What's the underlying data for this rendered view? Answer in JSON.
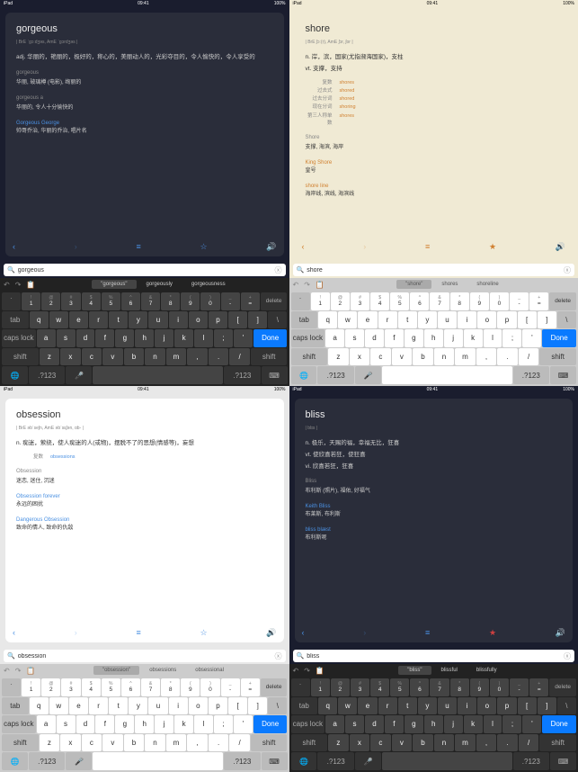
{
  "status_time": "09:41",
  "status_left": "iPad",
  "panels": [
    {
      "word": "gorgeous",
      "pron": "| BrE ˈɡɔːdʒəs, AmE ˈɡɔrdʒəs |",
      "defs": [
        "adj. 华丽的，艳丽的，极好的，称心的，美丽动人的，光彩夺目的，令人愉快的，令人享受的"
      ],
      "sections": [
        {
          "head": "gorgeous",
          "body": "华丽, 玻璃樽 (电影), 绚丽的"
        },
        {
          "head": "gorgeous a",
          "body": "华丽的, 令人十分愉快的"
        },
        {
          "head_link": "Gorgeous George",
          "body": "帅哥乔治, 华丽的乔治, 唱片名"
        }
      ],
      "search": "gorgeous",
      "suggest": [
        "\"gorgeous\"",
        "gorgeously",
        "gorgeousness"
      ]
    },
    {
      "word": "shore",
      "pron": "| BrE ʃɔː(r), AmE ʃɔr, ʃor |",
      "defs": [
        "n. 岸，滨，国家(尤指濒海国家)，支柱",
        "vt. 支撑，支持"
      ],
      "forms": [
        {
          "label": "复数",
          "value": "shores"
        },
        {
          "label": "过去式",
          "value": "shored"
        },
        {
          "label": "过去分词",
          "value": "shored"
        },
        {
          "label": "现在分词",
          "value": "shoring"
        },
        {
          "label": "第三人称单数",
          "value": "shores"
        }
      ],
      "sections": [
        {
          "head": "Shore",
          "body": "支撑, 海滨, 海岸"
        },
        {
          "head_link": "King Shore",
          "body": "皇号"
        },
        {
          "head_link": "shore line",
          "body": "海岸线, 滨线, 海滨线"
        }
      ],
      "search": "shore",
      "suggest": [
        "\"shore\"",
        "shores",
        "shoreline"
      ]
    },
    {
      "word": "obsession",
      "pron": "| BrE əbˈseʃn, AmE əbˈsɛʃən, ɑb- |",
      "defs": [
        "n. 痴迷，萦绕，使人痴迷的人(或物)，摆脱不了的思想(情感等)，妄想"
      ],
      "forms": [
        {
          "label": "复数",
          "value": "obsessions"
        }
      ],
      "sections": [
        {
          "head": "Obsession",
          "body": "迷恋, 迷住, 沉迷"
        },
        {
          "head_link": "Obsession forever",
          "body": "永远的困扰"
        },
        {
          "head_link": "Dangerous Obsession",
          "body": "致命的情人, 致命的仇敌"
        }
      ],
      "search": "obsession",
      "suggest": [
        "\"obsession\"",
        "obsessions",
        "obsessional"
      ]
    },
    {
      "word": "bliss",
      "pron": "| blɪs |",
      "defs": [
        "n. 极乐，天赐的福，幸福无比，狂喜",
        "vt. 使欣喜若狂，使狂喜",
        "vi. 欣喜若狂，狂喜"
      ],
      "sections": [
        {
          "head": "Bliss",
          "body": "布利斯 (照片), 福佑, 好福气"
        },
        {
          "head_link": "Keith Bliss",
          "body": "布莱斯, 布利斯"
        },
        {
          "head_link": "bliss blæst",
          "body": "布利斯呢"
        }
      ],
      "search": "bliss",
      "suggest": [
        "\"bliss\"",
        "blissful",
        "blissfully"
      ]
    }
  ],
  "keys": {
    "num_sym": [
      "!",
      "@",
      "#",
      "$",
      "%",
      "^",
      "&",
      "*",
      "(",
      ")",
      "_",
      "+"
    ],
    "num": [
      "1",
      "2",
      "3",
      "4",
      "5",
      "6",
      "7",
      "8",
      "9",
      "0",
      "-",
      "="
    ],
    "r1": [
      "q",
      "w",
      "e",
      "r",
      "t",
      "y",
      "u",
      "i",
      "o",
      "p",
      "[",
      "]"
    ],
    "r2": [
      "a",
      "s",
      "d",
      "f",
      "g",
      "h",
      "j",
      "k",
      "l",
      ";",
      "'"
    ],
    "r3": [
      "z",
      "x",
      "c",
      "v",
      "b",
      "n",
      "m",
      ",",
      ".",
      "/"
    ],
    "tab": "tab",
    "caps": "caps lock",
    "shift": "shift",
    "delete": "delete",
    "done": "Done",
    "numlabel": ".?123"
  }
}
